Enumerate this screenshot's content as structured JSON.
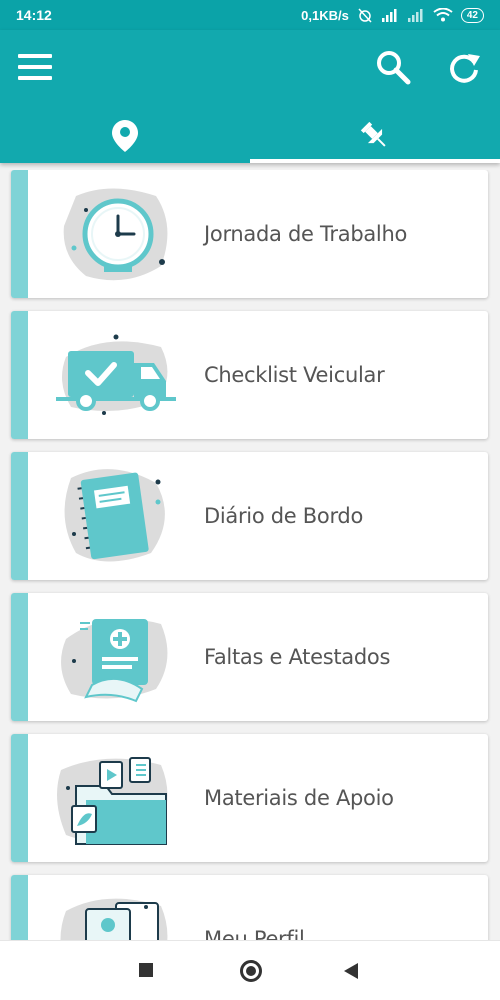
{
  "status_bar": {
    "time": "14:12",
    "network_speed": "0,1KB/s",
    "battery": "42"
  },
  "app_bar": {
    "menu_icon": "hamburger-menu-icon",
    "search_icon": "search-icon",
    "refresh_icon": "refresh-icon",
    "tabs": [
      {
        "icon": "location-pin-icon",
        "selected": false
      },
      {
        "icon": "pushpin-icon",
        "selected": true
      }
    ]
  },
  "menu": {
    "items": [
      {
        "label": "Jornada de Trabalho",
        "icon": "clock-illustration"
      },
      {
        "label": "Checklist Veicular",
        "icon": "truck-checklist-illustration"
      },
      {
        "label": "Diário de Bordo",
        "icon": "notebook-illustration"
      },
      {
        "label": "Faltas e Atestados",
        "icon": "medical-certificate-illustration"
      },
      {
        "label": "Materiais de Apoio",
        "icon": "media-folder-illustration"
      },
      {
        "label": "Meu Perfil",
        "icon": "profile-card-illustration"
      }
    ]
  },
  "colors": {
    "primary": "#12a9ae",
    "accent": "#7fd3d6",
    "illustration": "#5fc7cb",
    "blob": "#dcdcdc"
  },
  "nav_bar": {
    "recents_icon": "square-recents-icon",
    "home_icon": "circle-home-icon",
    "back_icon": "triangle-back-icon"
  }
}
